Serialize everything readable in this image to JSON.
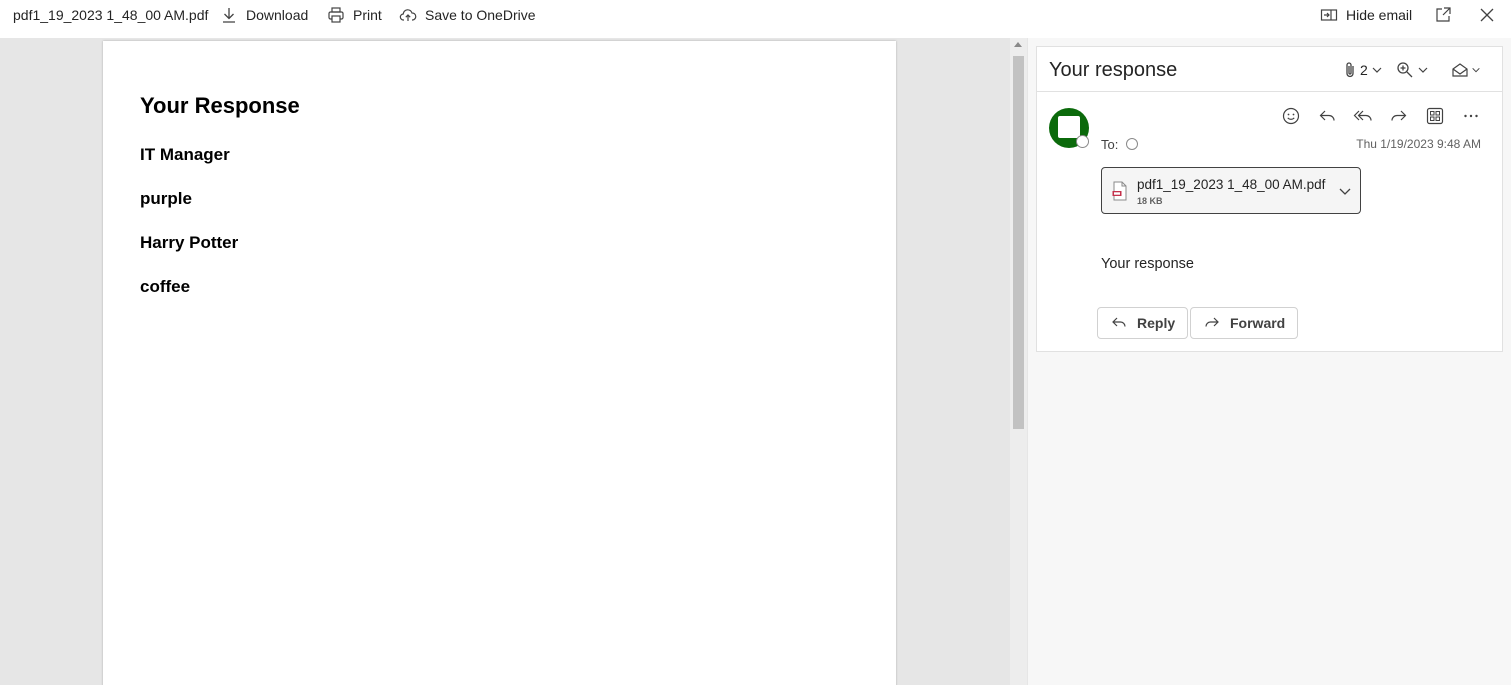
{
  "toolbar": {
    "filename": "pdf1_19_2023 1_48_00 AM.pdf",
    "download_label": "Download",
    "print_label": "Print",
    "save_label": "Save to OneDrive",
    "hide_email_label": "Hide email"
  },
  "pdf": {
    "heading": "Your Response",
    "lines": [
      "IT Manager",
      "purple",
      "Harry Potter",
      "coffee"
    ]
  },
  "email": {
    "subject": "Your response",
    "attachment_count": "2",
    "to_label": "To:",
    "date": "Thu 1/19/2023 9:48 AM",
    "attachment": {
      "name": "pdf1_19_2023 1_48_00 AM.pdf",
      "size": "18 KB"
    },
    "body": "Your response",
    "reply_label": "Reply",
    "forward_label": "Forward",
    "avatar_color": "#0b6a0b"
  }
}
